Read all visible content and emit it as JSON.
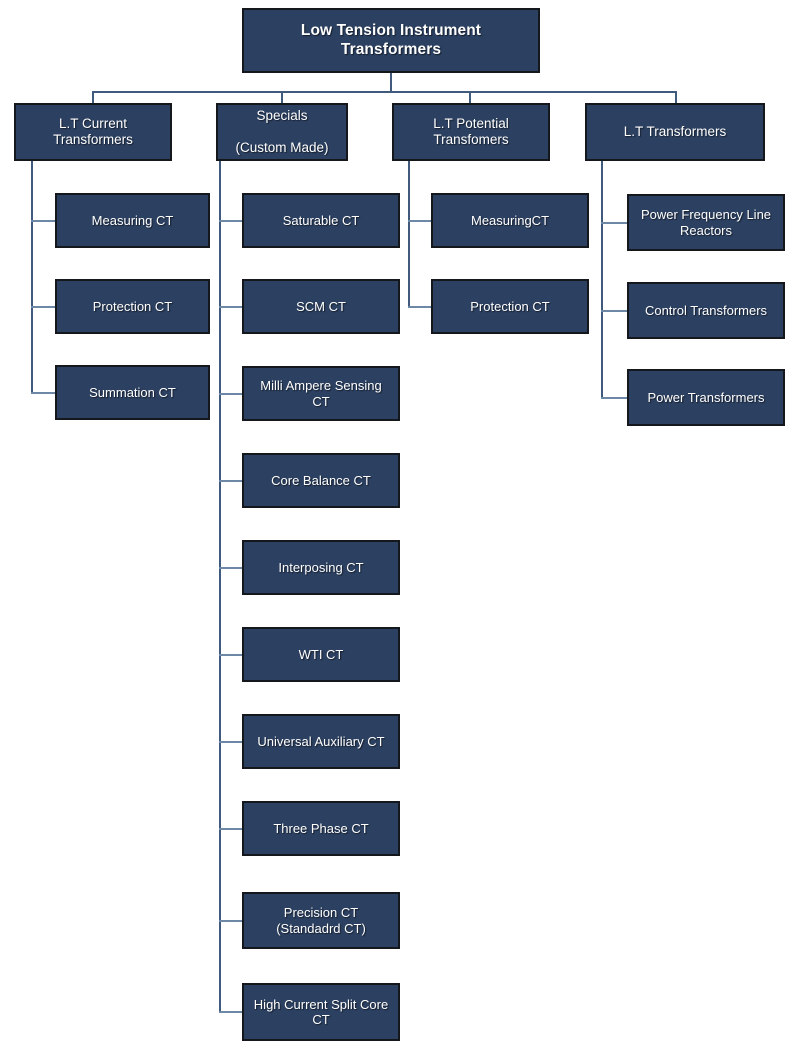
{
  "diagram": {
    "title": "Low Tension Instrument Transformers",
    "type": "organizational-tree",
    "colors": {
      "node_fill": "#2c4061",
      "node_border": "#14171c",
      "node_text": "#ffffff",
      "connector": "#3f5a7d",
      "background": "#ffffff"
    },
    "root": {
      "label": "Low Tension Instrument Transformers"
    },
    "branches": [
      {
        "id": "lt-current-transformers",
        "label": "L.T Current Transformers",
        "children": [
          {
            "label": "Measuring CT"
          },
          {
            "label": "Protection CT"
          },
          {
            "label": "Summation CT"
          }
        ]
      },
      {
        "id": "specials-custom-made",
        "label": "Specials (Custom Made)",
        "line1": "Specials",
        "line2": "(Custom Made)",
        "children": [
          {
            "label": "Saturable CT"
          },
          {
            "label": "SCM CT"
          },
          {
            "label": "Milli Ampere Sensing CT"
          },
          {
            "label": "Core Balance CT"
          },
          {
            "label": "Interposing CT"
          },
          {
            "label": "WTI CT"
          },
          {
            "label": "Universal Auxiliary CT"
          },
          {
            "label": "Three Phase CT"
          },
          {
            "label": "Precision CT (Standadrd CT)"
          },
          {
            "label": "High Current Split Core CT"
          }
        ]
      },
      {
        "id": "lt-potential-transfomers",
        "label": "L.T Potential Transfomers",
        "children": [
          {
            "label": "MeasuringCT"
          },
          {
            "label": "Protection CT"
          }
        ]
      },
      {
        "id": "lt-transformers",
        "label": "L.T Transformers",
        "children": [
          {
            "label": "Power Frequency Line Reactors"
          },
          {
            "label": "Control Transformers"
          },
          {
            "label": "Power Transformers"
          }
        ]
      }
    ]
  }
}
